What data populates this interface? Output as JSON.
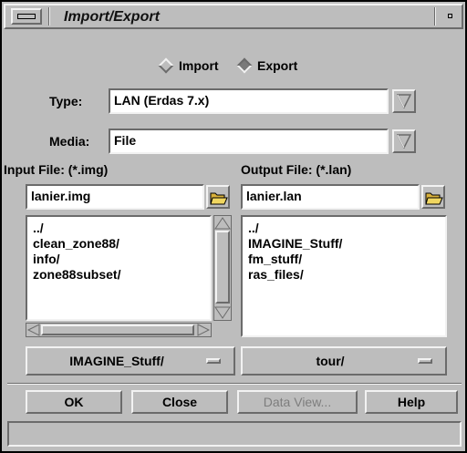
{
  "window": {
    "title": "Import/Export"
  },
  "mode": {
    "import_label": "Import",
    "export_label": "Export",
    "selected": "Export"
  },
  "type": {
    "label": "Type:",
    "value": "LAN (Erdas 7.x)"
  },
  "media": {
    "label": "Media:",
    "value": "File"
  },
  "input": {
    "label": "Input File: (*.img)",
    "filename": "lanier.img",
    "items": [
      "../",
      "clean_zone88/",
      "info/",
      "zone88subset/"
    ],
    "directory": "IMAGINE_Stuff/"
  },
  "output": {
    "label": "Output File: (*.lan)",
    "filename": "lanier.lan",
    "items": [
      "../",
      "IMAGINE_Stuff/",
      "fm_stuff/",
      "ras_files/"
    ],
    "directory": "tour/"
  },
  "buttons": {
    "ok": "OK",
    "close": "Close",
    "data_view": "Data View...",
    "help": "Help"
  },
  "colors": {
    "background": "#bdbdbd",
    "field": "#ffffff",
    "folder": "#e8c84a"
  }
}
